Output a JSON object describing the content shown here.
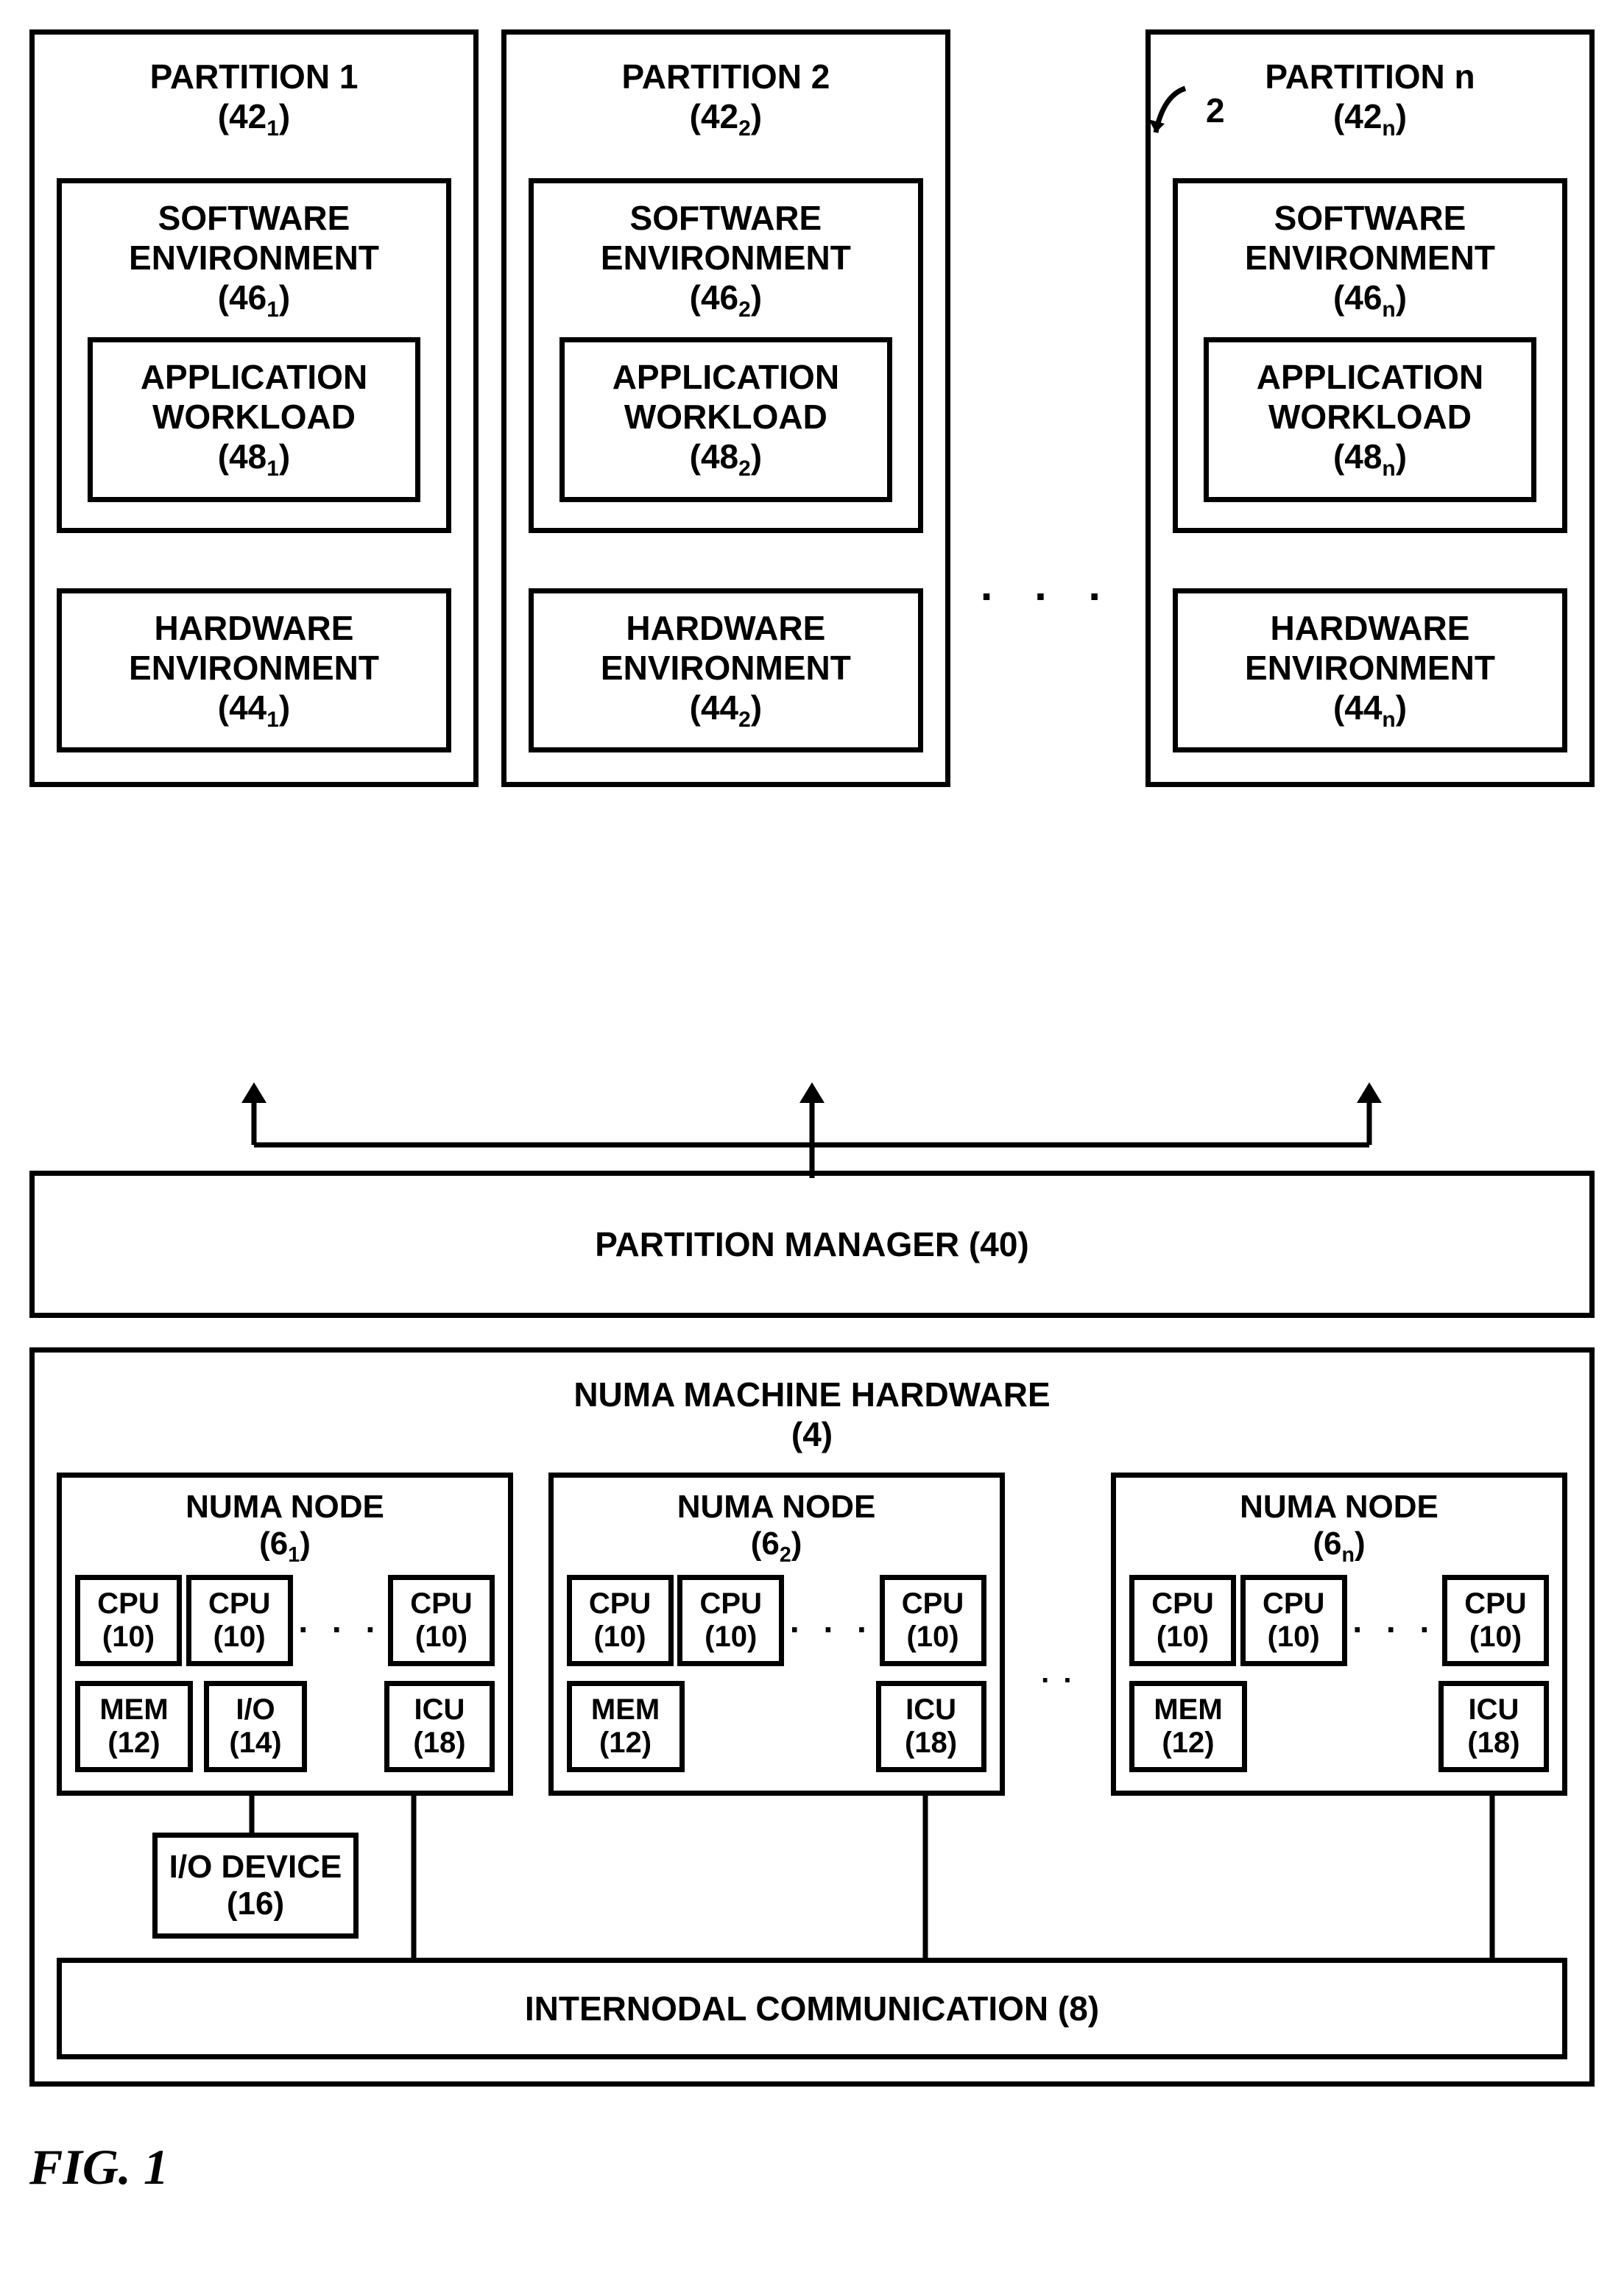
{
  "system_ref": "2",
  "partitions": [
    {
      "title_line1": "PARTITION 1",
      "title_line2": "(42",
      "title_sub": "1",
      "sw_line1": "SOFTWARE",
      "sw_line2": "ENVIRONMENT",
      "sw_ref": "(46",
      "sw_sub": "1",
      "app_line1": "APPLICATION",
      "app_line2": "WORKLOAD",
      "app_ref": "(48",
      "app_sub": "1",
      "hw_line1": "HARDWARE",
      "hw_line2": "ENVIRONMENT",
      "hw_ref": "(44",
      "hw_sub": "1"
    },
    {
      "title_line1": "PARTITION 2",
      "title_line2": "(42",
      "title_sub": "2",
      "sw_line1": "SOFTWARE",
      "sw_line2": "ENVIRONMENT",
      "sw_ref": "(46",
      "sw_sub": "2",
      "app_line1": "APPLICATION",
      "app_line2": "WORKLOAD",
      "app_ref": "(48",
      "app_sub": "2",
      "hw_line1": "HARDWARE",
      "hw_line2": "ENVIRONMENT",
      "hw_ref": "(44",
      "hw_sub": "2"
    },
    {
      "title_line1": "PARTITION n",
      "title_line2": "(42",
      "title_sub": "n",
      "sw_line1": "SOFTWARE",
      "sw_line2": "ENVIRONMENT",
      "sw_ref": "(46",
      "sw_sub": "n",
      "app_line1": "APPLICATION",
      "app_line2": "WORKLOAD",
      "app_ref": "(48",
      "app_sub": "n",
      "hw_line1": "HARDWARE",
      "hw_line2": "ENVIRONMENT",
      "hw_ref": "(44",
      "hw_sub": "n"
    }
  ],
  "ellipsis": ". . .",
  "ellipsis_small": ". .",
  "partition_manager": "PARTITION MANAGER (40)",
  "numa_title_line1": "NUMA MACHINE HARDWARE",
  "numa_title_line2": "(4)",
  "numa_nodes": [
    {
      "title": "NUMA NODE",
      "ref": "(6",
      "sub": "1",
      "has_io": true
    },
    {
      "title": "NUMA NODE",
      "ref": "(6",
      "sub": "2",
      "has_io": false
    },
    {
      "title": "NUMA NODE",
      "ref": "(6",
      "sub": "n",
      "has_io": false
    }
  ],
  "cpu_label": "CPU",
  "cpu_ref": "(10)",
  "mem_label": "MEM",
  "mem_ref": "(12)",
  "io_label": "I/O",
  "io_ref": "(14)",
  "icu_label": "ICU",
  "icu_ref": "(18)",
  "io_device_line1": "I/O DEVICE",
  "io_device_line2": "(16)",
  "internodal": "INTERNODAL COMMUNICATION (8)",
  "figure_caption": "FIG. 1"
}
